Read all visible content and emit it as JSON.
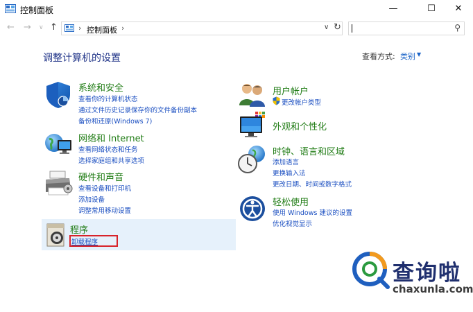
{
  "window": {
    "title": "控制面板",
    "minimize": "—",
    "maximize": "☐",
    "close": "✕"
  },
  "nav": {
    "back": "←",
    "forward": "→",
    "dropdown": "∨",
    "up": "↑"
  },
  "address": {
    "sep1": "›",
    "crumb": "控制面板",
    "sep2": "›",
    "dropdown": "∨",
    "refresh": "↻"
  },
  "search": {
    "icon": "⚲"
  },
  "main": {
    "heading": "调整计算机的设置",
    "view_by_label": "查看方式:",
    "view_by_value": "类别",
    "view_by_arrow": "▼"
  },
  "categories": {
    "system": {
      "title": "系统和安全",
      "icon": "shield-icon",
      "links": [
        "查看你的计算机状态",
        "通过文件历史记录保存你的文件备份副本",
        "备份和还原(Windows 7)"
      ]
    },
    "network": {
      "title": "网络和 Internet",
      "icon": "globe-network-icon",
      "links": [
        "查看网络状态和任务",
        "选择家庭组和共享选项"
      ]
    },
    "hardware": {
      "title": "硬件和声音",
      "icon": "printer-icon",
      "links": [
        "查看设备和打印机",
        "添加设备",
        "调整常用移动设置"
      ]
    },
    "programs": {
      "title": "程序",
      "icon": "programs-disc-icon",
      "links": [
        "卸载程序"
      ]
    },
    "accounts": {
      "title": "用户帐户",
      "icon": "users-icon",
      "links": [
        "更改帐户类型"
      ]
    },
    "appearance": {
      "title": "外观和个性化",
      "icon": "monitor-color-icon",
      "links": []
    },
    "clock": {
      "title": "时钟、语言和区域",
      "icon": "clock-globe-icon",
      "links": [
        "添加语言",
        "更换输入法",
        "更改日期、时间或数字格式"
      ]
    },
    "ease": {
      "title": "轻松使用",
      "icon": "ease-of-access-icon",
      "links": [
        "使用 Windows 建议的设置",
        "优化视觉显示"
      ]
    }
  },
  "watermark": {
    "cn": "查询啦",
    "en": "chaxunla.com"
  },
  "colors": {
    "category_title": "#207c15",
    "link": "#1b4fc1",
    "heading": "#1e3287",
    "highlight_bg": "#e6f1fb",
    "annotation_box": "#d8232a"
  }
}
